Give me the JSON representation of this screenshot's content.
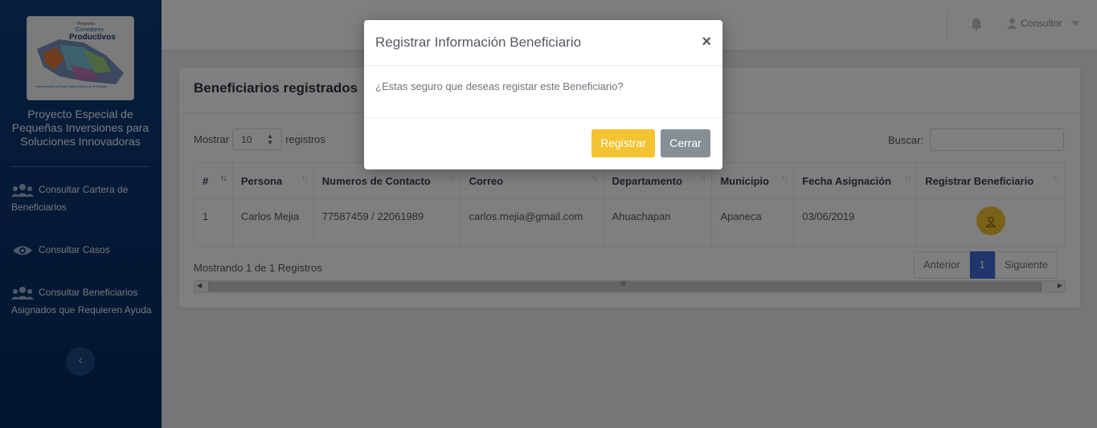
{
  "sidebar": {
    "logo": {
      "small": "Programa",
      "line1": "Corredores",
      "line2": "Productivos",
      "tagline": "Transformando la Franja Costero-Marina de El Salvador"
    },
    "project_title": "Proyecto Especial de Pequeñas Inversiones para Soluciones Innovadoras",
    "items": [
      {
        "label": "Consultar Cartera de Beneficiarios",
        "icon": "users-icon"
      },
      {
        "label": "Consultar Casos",
        "icon": "eye-icon"
      },
      {
        "label": "Consultar Beneficiarios Asignados que Requieren Ayuda",
        "icon": "users-icon"
      }
    ],
    "collapse_glyph": "‹"
  },
  "header": {
    "user_label": "Consultor"
  },
  "card": {
    "title": "Beneficiarios registrados",
    "length_prefix": "Mostrar",
    "length_value": "10",
    "length_suffix": "registros",
    "search_label": "Buscar:",
    "search_value": "",
    "columns": [
      "#",
      "Persona",
      "Numeros de Contacto",
      "Correo",
      "Departamento",
      "Municipio",
      "Fecha Asignación",
      "Registrar Beneficiario"
    ],
    "rows": [
      {
        "num": "1",
        "persona": "Carlos Mejia",
        "contacto": "77587459 / 22061989",
        "correo": "carlos.mejia@gmail.com",
        "departamento": "Ahuachapan",
        "municipio": "Apaneca",
        "fecha": "03/06/2019"
      }
    ],
    "info": "Mostrando 1 de 1 Registros",
    "pager": {
      "prev": "Anterior",
      "page": "1",
      "next": "Siguiente"
    },
    "scroll_grip": "III"
  },
  "modal": {
    "title": "Registrar Información Beneficiario",
    "close_glyph": "×",
    "body": "¿Estas seguro que deseas registar este Beneficiario?",
    "confirm_label": "Registrar",
    "cancel_label": "Cerrar"
  },
  "colors": {
    "sidebar": "#0a3570",
    "accent_yellow": "#f4c331",
    "pager_active": "#3f6ad8",
    "cancel_gray": "#868e96"
  }
}
